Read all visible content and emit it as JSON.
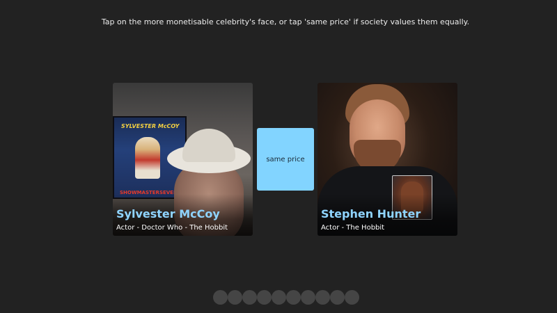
{
  "instruction": "Tap on the more monetisable celebrity's face, or tap 'same price' if society values them equally.",
  "left_card": {
    "name": "Sylvester McCoy",
    "role": "Actor - Doctor Who - The Hobbit",
    "poster_title": "SYLVESTER McCOY",
    "poster_banner": "SHOWMASTERSEVENTS"
  },
  "right_card": {
    "name": "Stephen Hunter",
    "role": "Actor - The Hobbit"
  },
  "same_price_label": "same price",
  "progress": {
    "total": 10,
    "completed": 0
  },
  "colors": {
    "background": "#222222",
    "name_accent": "#8fd4ff",
    "same_price_button": "#82d4ff",
    "progress_dot": "#454545"
  }
}
